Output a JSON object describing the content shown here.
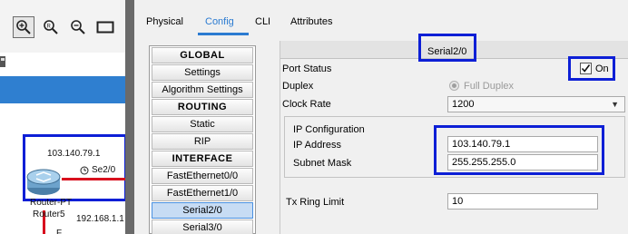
{
  "workspace": {
    "tools": [
      "magnify-icon",
      "search-icon",
      "zoom-out-icon",
      "rectangle-icon"
    ],
    "device_label": "Router-PT",
    "device_name": "Router5",
    "ip_label": "103.140.79.1",
    "interface_label": "Se2/0",
    "ip2_label": "192.168.1.1",
    "partial_label": "F"
  },
  "tabs": [
    {
      "label": "Physical"
    },
    {
      "label": "Config"
    },
    {
      "label": "CLI"
    },
    {
      "label": "Attributes"
    }
  ],
  "sidebar": {
    "items": [
      {
        "label": "GLOBAL"
      },
      {
        "label": "Settings"
      },
      {
        "label": "Algorithm Settings"
      },
      {
        "label": "ROUTING"
      },
      {
        "label": "Static"
      },
      {
        "label": "RIP"
      },
      {
        "label": "INTERFACE"
      },
      {
        "label": "FastEthernet0/0"
      },
      {
        "label": "FastEthernet1/0"
      },
      {
        "label": "Serial2/0"
      },
      {
        "label": "Serial3/0"
      }
    ]
  },
  "content": {
    "title": "Serial2/0",
    "port_status_label": "Port Status",
    "port_status_on_label": "On",
    "duplex_label": "Duplex",
    "duplex_value": "Full Duplex",
    "clock_rate_label": "Clock Rate",
    "clock_rate_value": "1200",
    "ip_config_label": "IP Configuration",
    "ip_address_label": "IP Address",
    "ip_address_value": "103.140.79.1",
    "subnet_mask_label": "Subnet Mask",
    "subnet_mask_value": "255.255.255.0",
    "tx_ring_label": "Tx Ring Limit",
    "tx_ring_value": "10"
  },
  "colors": {
    "annotation": "#0d1fd6",
    "accent": "#2b7bd1",
    "link": "#d8101e"
  }
}
